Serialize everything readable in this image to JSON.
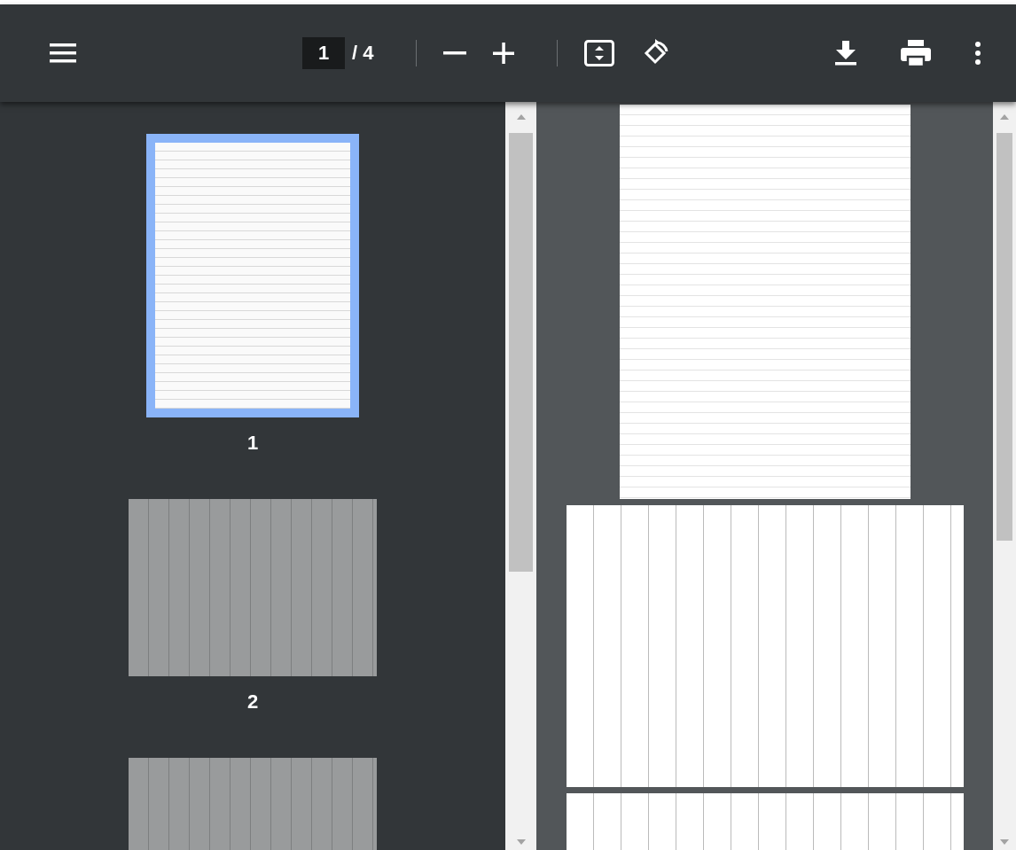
{
  "toolbar": {
    "page_input": "1",
    "page_total": "/ 4"
  },
  "thumbnails": [
    {
      "label": "1",
      "selected": true,
      "kind": "portrait"
    },
    {
      "label": "2",
      "selected": false,
      "kind": "landscape"
    },
    {
      "selected": false,
      "kind": "landscape"
    }
  ],
  "pages": [
    {
      "kind": "portrait"
    },
    {
      "kind": "landscape"
    },
    {
      "kind": "landscape"
    }
  ]
}
